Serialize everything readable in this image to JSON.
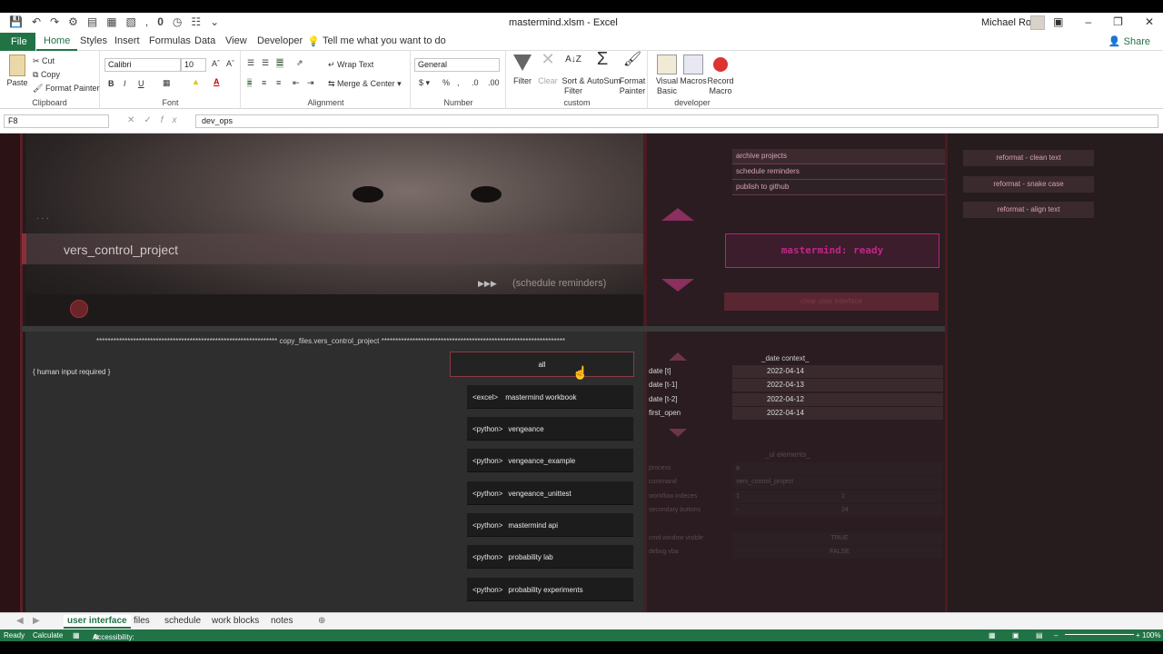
{
  "window": {
    "title": "mastermind.xlsm  -  Excel",
    "user": "Michael Ross",
    "qa_number": "0"
  },
  "ribbon_tabs": [
    "File",
    "Home",
    "Styles",
    "Insert",
    "Formulas",
    "Data",
    "View",
    "Developer"
  ],
  "tell_me": "Tell me what you want to do",
  "share": "Share",
  "clipboard": {
    "paste": "Paste",
    "cut": "Cut",
    "copy": "Copy",
    "format_painter": "Format Painter",
    "label": "Clipboard"
  },
  "font": {
    "name": "Calibri",
    "size": "10",
    "bold": "B",
    "italic": "I",
    "underline": "U",
    "label": "Font"
  },
  "alignment": {
    "wrap": "Wrap Text",
    "merge": "Merge & Center",
    "label": "Alignment"
  },
  "number": {
    "format": "General",
    "label": "Number"
  },
  "custom": {
    "filter": "Filter",
    "clear": "Clear",
    "sort1": "Sort &",
    "sort2": "Filter",
    "autosum": "AutoSum",
    "fp1": "Format",
    "fp2": "Painter",
    "label": "custom"
  },
  "developer": {
    "vb1": "Visual",
    "vb2": "Basic",
    "macros": "Macros",
    "rm1": "Record",
    "rm2": "Macro",
    "label": "developer"
  },
  "formula_bar": {
    "cell": "F8",
    "value": "dev_ops"
  },
  "hero": {
    "dots": ". . .",
    "project": "vers_control_project",
    "schedule_hint": "(schedule reminders)"
  },
  "top_actions": [
    "archive projects",
    "schedule reminders",
    "publish to github"
  ],
  "status_display": "mastermind: ready",
  "clear_ui": "clear user interface",
  "reformat": [
    "reformat - clean text",
    "reformat - snake case",
    "reformat - align text"
  ],
  "copy_header": "copy_files.vers_control_project",
  "human_input": "{ human input required }",
  "all_button": "all",
  "file_list": [
    {
      "tag": "<excel>",
      "name": "mastermind workbook"
    },
    {
      "tag": "<python>",
      "name": "vengeance"
    },
    {
      "tag": "<python>",
      "name": "vengeance_example"
    },
    {
      "tag": "<python>",
      "name": "vengeance_unittest"
    },
    {
      "tag": "<python>",
      "name": "mastermind api"
    },
    {
      "tag": "<python>",
      "name": "probability lab"
    },
    {
      "tag": "<python>",
      "name": "probability experiments"
    }
  ],
  "date_context": {
    "title": "_date context_",
    "rows": [
      {
        "k": "date [t]",
        "v": "2022-04-14"
      },
      {
        "k": "date [t-1]",
        "v": "2022-04-13"
      },
      {
        "k": "date [t-2]",
        "v": "2022-04-12"
      },
      {
        "k": "first_open",
        "v": "2022-04-14"
      }
    ]
  },
  "ui_elements": {
    "title": "_ui elements_",
    "process": {
      "k": "process",
      "v": "a"
    },
    "command": {
      "k": "command",
      "v": "vers_control_project"
    },
    "workflow": {
      "k": "workflow indeces",
      "v1": "1",
      "v2": "1"
    },
    "secondary": {
      "k": "secondary buttons",
      "v1": "-",
      "v2": "24"
    },
    "cmd_visible": {
      "k": "cmd window visible",
      "v": "TRUE"
    },
    "debug": {
      "k": "debug vba",
      "v": "FALSE"
    }
  },
  "sheet_tabs": [
    "user interface",
    "files",
    "schedule",
    "work blocks",
    "notes"
  ],
  "status": {
    "ready": "Ready",
    "calc": "Calculate",
    "access": "Accessibility: Investigate",
    "zoom": "100%"
  },
  "colors": {
    "excel_green": "#217346",
    "magenta": "#c0278a",
    "dark": "#231a1c"
  }
}
